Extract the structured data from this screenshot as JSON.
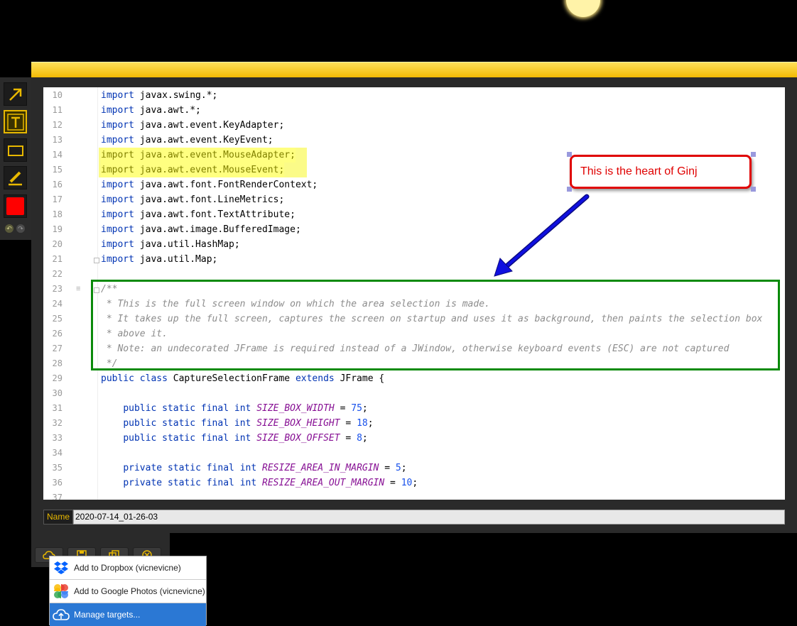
{
  "toolbar": {
    "tools": [
      {
        "name": "arrow-tool",
        "icon": "arrow-icon"
      },
      {
        "name": "text-tool",
        "icon": "text-icon",
        "selected": true
      },
      {
        "name": "rectangle-tool",
        "icon": "rectangle-icon"
      },
      {
        "name": "highlighter-tool",
        "icon": "highlighter-icon"
      },
      {
        "name": "color-picker",
        "icon": "color-swatch",
        "color": "#ff0000"
      }
    ],
    "undo_icon": "undo-icon",
    "redo_icon": "redo-icon"
  },
  "editor": {
    "lines": [
      {
        "n": "10",
        "code": "import javax.swing.*;"
      },
      {
        "n": "11",
        "code": "import java.awt.*;"
      },
      {
        "n": "12",
        "code": "import java.awt.event.KeyAdapter;"
      },
      {
        "n": "13",
        "code": "import java.awt.event.KeyEvent;"
      },
      {
        "n": "14",
        "code": "import java.awt.event.MouseAdapter;"
      },
      {
        "n": "15",
        "code": "import java.awt.event.MouseEvent;"
      },
      {
        "n": "16",
        "code": "import java.awt.font.FontRenderContext;"
      },
      {
        "n": "17",
        "code": "import java.awt.font.LineMetrics;"
      },
      {
        "n": "18",
        "code": "import java.awt.font.TextAttribute;"
      },
      {
        "n": "19",
        "code": "import java.awt.image.BufferedImage;"
      },
      {
        "n": "20",
        "code": "import java.util.HashMap;"
      },
      {
        "n": "21",
        "code": "import java.util.Map;"
      },
      {
        "n": "22",
        "code": ""
      },
      {
        "n": "23",
        "code": "/**"
      },
      {
        "n": "24",
        "code": " * This is the full screen window on which the area selection is made."
      },
      {
        "n": "25",
        "code": " * It takes up the full screen, captures the screen on startup and uses it as background, then paints the selection box"
      },
      {
        "n": "26",
        "code": " * above it."
      },
      {
        "n": "27",
        "code": " * Note: an undecorated JFrame is required instead of a JWindow, otherwise keyboard events (ESC) are not captured"
      },
      {
        "n": "28",
        "code": " */"
      },
      {
        "n": "29",
        "code": "public class CaptureSelectionFrame extends JFrame {"
      },
      {
        "n": "30",
        "code": ""
      },
      {
        "n": "31",
        "code": "    public static final int SIZE_BOX_WIDTH = 75;"
      },
      {
        "n": "32",
        "code": "    public static final int SIZE_BOX_HEIGHT = 18;"
      },
      {
        "n": "33",
        "code": "    public static final int SIZE_BOX_OFFSET = 8;"
      },
      {
        "n": "34",
        "code": ""
      },
      {
        "n": "35",
        "code": "    private static final int RESIZE_AREA_IN_MARGIN = 5;"
      },
      {
        "n": "36",
        "code": "    private static final int RESIZE_AREA_OUT_MARGIN = 10;"
      },
      {
        "n": "37",
        "code": ""
      }
    ]
  },
  "annotations": {
    "callout_text": "This is the heart of Ginj",
    "callout_color": "#e00000",
    "arrow_color": "#1010e0",
    "box_color": "#0a8a0a",
    "highlight_color": "#ffff80"
  },
  "namebar": {
    "label": "Name",
    "value": "2020-07-14_01-26-03"
  },
  "actions": {
    "share_icon": "cloud-upload-icon",
    "save_icon": "save-icon",
    "copy_icon": "copy-icon",
    "cancel_icon": "cancel-icon"
  },
  "share_menu": {
    "items": [
      {
        "label": "Add to Dropbox (vicnevicne)",
        "icon": "dropbox-icon"
      },
      {
        "label": "Add to Google Photos (vicnevicne)",
        "icon": "google-photos-icon"
      },
      {
        "label": "Manage targets...",
        "icon": "cloud-upload-icon"
      }
    ]
  }
}
